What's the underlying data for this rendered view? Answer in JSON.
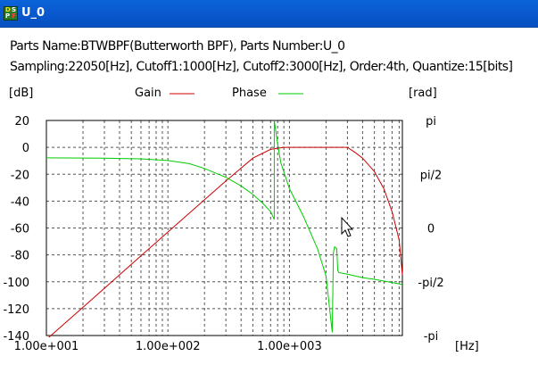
{
  "window": {
    "title": "U_0"
  },
  "info": {
    "line1": "Parts Name:BTWBPF(Butterworth BPF), Parts Number:U_0",
    "line2": "Sampling:22050[Hz], Cutoff1:1000[Hz], Cutoff2:3000[Hz], Order:4th, Quantize:15[bits]"
  },
  "chart_data": {
    "type": "line",
    "xscale": "log",
    "xlim": [
      10,
      8500
    ],
    "ylim": [
      -140,
      20
    ],
    "yticks": [
      20,
      0,
      -20,
      -40,
      -60,
      -80,
      -100,
      -120,
      -140
    ],
    "ytick_labels": [
      "20",
      "0",
      "-20",
      "-40",
      "-60",
      "-80",
      "-100",
      "-120",
      "-140"
    ],
    "xtick_labels": [
      "1.00e+001",
      "1.00e+002",
      "1.00e+003"
    ],
    "xtick_values": [
      10,
      100,
      1000
    ],
    "y2lim": [
      -3.1416,
      3.1416
    ],
    "y2tick_labels": [
      "pi",
      "pi/2",
      "0",
      "-pi/2",
      "-pi"
    ],
    "y2tick_values": [
      3.1416,
      1.5708,
      0,
      -1.5708,
      -3.1416
    ],
    "ylabel": "[dB]",
    "y2label": "[rad]",
    "xlabel": "[Hz]",
    "grid": true,
    "legend_position": "top",
    "series": [
      {
        "name": "Gain",
        "color": "#cc0000",
        "axis": "left",
        "x": [
          10,
          20,
          50,
          100,
          200,
          300,
          500,
          700,
          900,
          1000,
          1500,
          2000,
          2500,
          3000,
          3500,
          4000,
          5000,
          6000,
          7000,
          8000,
          8500
        ],
        "y": [
          -143,
          -119,
          -87,
          -63,
          -39,
          -25,
          -8,
          -1.5,
          0,
          0,
          0,
          0,
          0,
          0,
          -4,
          -8,
          -18,
          -31,
          -48,
          -69,
          -95
        ]
      },
      {
        "name": "Phase",
        "color": "#00cc00",
        "axis": "right",
        "x": [
          10,
          30,
          60,
          100,
          150,
          200,
          300,
          400,
          500,
          600,
          700,
          750,
          750,
          800,
          850,
          1000,
          1300,
          1700,
          2000,
          2250,
          2300,
          2350,
          2450,
          2500,
          2550,
          3000,
          4000,
          5000,
          6000,
          8500
        ],
        "y": [
          2.05,
          2.04,
          2.02,
          1.97,
          1.88,
          1.74,
          1.48,
          1.23,
          0.98,
          0.73,
          0.48,
          0.25,
          3.14,
          2.45,
          1.9,
          1.15,
          0.35,
          -0.6,
          -1.4,
          -3.05,
          -0.72,
          -0.55,
          -0.6,
          -1.25,
          -1.3,
          -1.35,
          -1.45,
          -1.5,
          -1.55,
          -1.65
        ]
      }
    ]
  }
}
